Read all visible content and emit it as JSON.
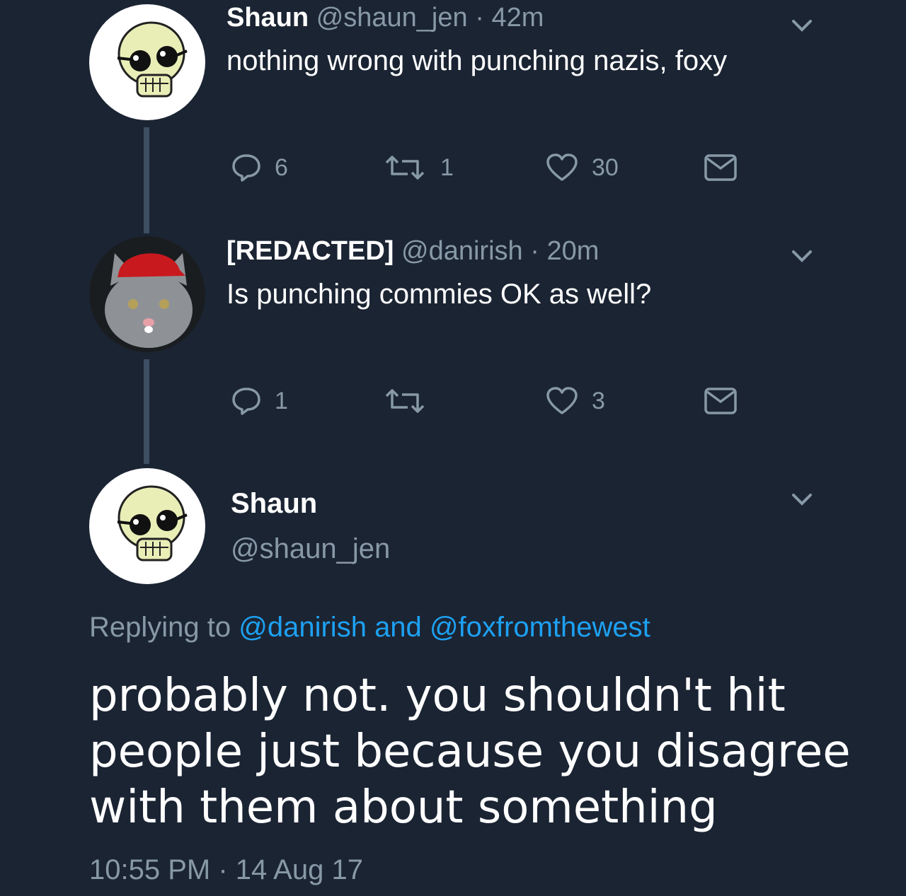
{
  "tweets": [
    {
      "name": "Shaun",
      "handle": "@shaun_jen",
      "separator": "·",
      "time": "42m",
      "text": "nothing wrong with punching nazis, foxy",
      "replies": "6",
      "retweets": "1",
      "likes": "30"
    },
    {
      "name": "[REDACTED]",
      "handle": "@danirish",
      "separator": "·",
      "time": "20m",
      "text": "Is punching commies OK as well?",
      "replies": "1",
      "retweets": "",
      "likes": "3"
    }
  ],
  "main_tweet": {
    "name": "Shaun",
    "handle": "@shaun_jen",
    "replying_prefix": "Replying to",
    "replying_user1": "@danirish",
    "replying_and": "and",
    "replying_user2": "@foxfromthewest",
    "text": "probably not. you shouldn't hit people just because you disagree with them about something",
    "timestamp": "10:55 PM · 14 Aug 17"
  },
  "icons": {
    "reply": "speech-bubble-icon",
    "retweet": "retweet-arrows-icon",
    "like": "heart-icon",
    "dm": "envelope-icon",
    "menu": "chevron-down-icon"
  },
  "colors": {
    "background": "#1b2433",
    "muted": "#8899a6",
    "link": "#1da1f2",
    "thread_line": "#3d4f63"
  }
}
